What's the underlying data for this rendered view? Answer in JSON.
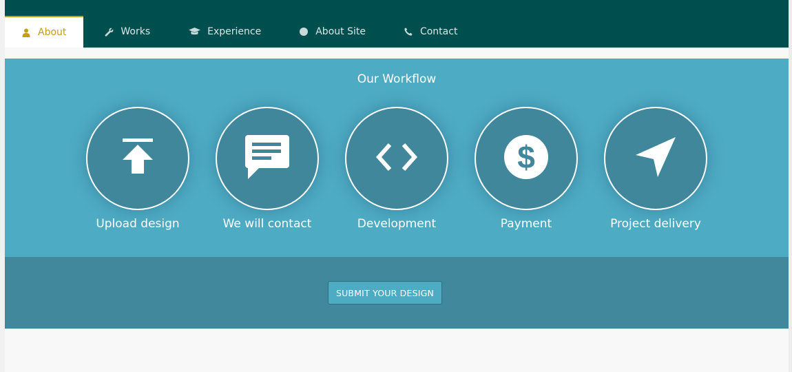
{
  "nav": {
    "tabs": [
      {
        "label": "About",
        "icon": "user-icon",
        "active": true
      },
      {
        "label": "Works",
        "icon": "wrench-icon",
        "active": false
      },
      {
        "label": "Experience",
        "icon": "graduation-cap-icon",
        "active": false
      },
      {
        "label": "About Site",
        "icon": "info-icon",
        "active": false
      },
      {
        "label": "Contact",
        "icon": "phone-icon",
        "active": false
      }
    ]
  },
  "workflow": {
    "title": "Our Workflow",
    "steps": [
      {
        "label": "Upload design",
        "icon": "upload-icon"
      },
      {
        "label": "We will contact",
        "icon": "chat-icon"
      },
      {
        "label": "Development",
        "icon": "code-icon"
      },
      {
        "label": "Payment",
        "icon": "dollar-icon"
      },
      {
        "label": "Project delivery",
        "icon": "send-icon"
      }
    ]
  },
  "submit": {
    "label": "SUBMIT YOUR DESIGN"
  },
  "colors": {
    "topbar": "#004f4f",
    "accent": "#c89b18",
    "workflow_bg": "#4eabc4",
    "circle_bg": "#40879b",
    "submit_band": "#41889c"
  }
}
